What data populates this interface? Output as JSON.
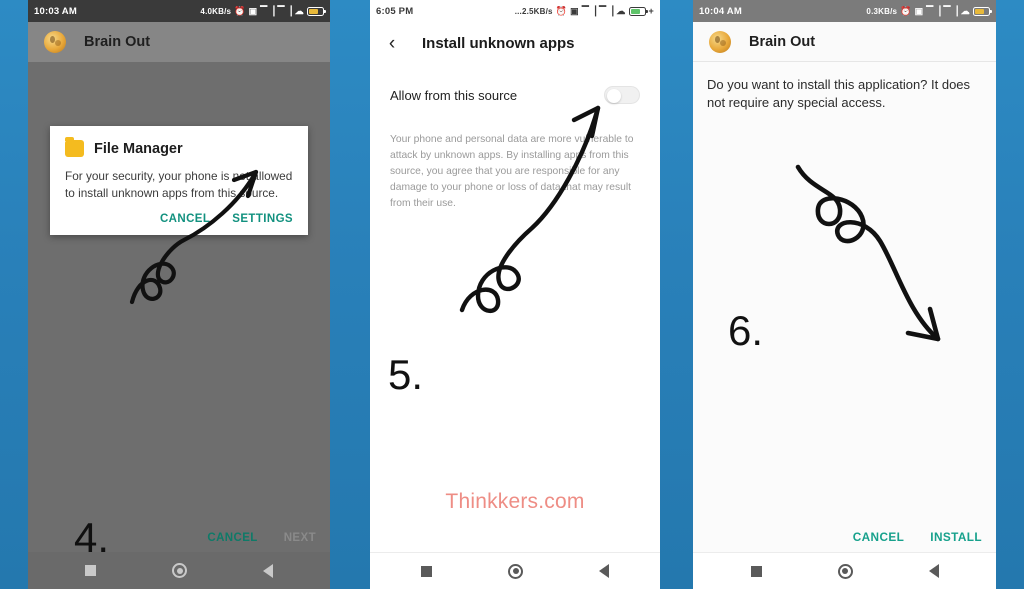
{
  "background": {
    "color_top": "#2d8bc4",
    "color_bottom": "#2478ae"
  },
  "panels": [
    {
      "id": "panel-1",
      "statusbar": {
        "time": "10:03 AM",
        "net_speed": "4.0KB/s",
        "icons": [
          "alarm-icon",
          "sd-card-icon",
          "signal-1-icon",
          "signal-2-icon",
          "wifi-icon",
          "battery-icon"
        ]
      },
      "appbar": {
        "title": "Brain Out",
        "icon": "brain-out-app-icon"
      },
      "dialog": {
        "icon": "folder-icon",
        "title": "File Manager",
        "message": "For your security, your phone is not allowed to install unknown apps from this source.",
        "cancel_label": "CANCEL",
        "settings_label": "SETTINGS",
        "action_color": "#12917f"
      },
      "bottom_actions": {
        "cancel_label": "CANCEL",
        "next_label": "NEXT",
        "next_disabled": true
      },
      "step_number": "4.",
      "navbar": {
        "recents": "recents-square-icon",
        "home": "home-circle-icon",
        "back": "back-triangle-icon"
      }
    },
    {
      "id": "panel-2",
      "statusbar": {
        "time": "6:05 PM",
        "net_speed": "...2.5KB/s",
        "icons": [
          "alarm-icon",
          "sd-card-icon",
          "signal-1-icon",
          "signal-2-icon",
          "wifi-icon",
          "battery-charging-icon"
        ]
      },
      "appbar": {
        "back_icon": "back-chevron-icon",
        "title": "Install unknown apps"
      },
      "setting": {
        "label": "Allow from this source",
        "toggle_state": "off",
        "toggle_name": "allow-from-this-source-toggle"
      },
      "description": "Your phone and personal data are more vulnerable to attack by unknown apps. By installing apps from this source, you agree that you are responsible for any damage to your phone or loss of data that may result from their use.",
      "watermark": "Thinkkers.com",
      "watermark_color": "#ee8d85",
      "step_number": "5.",
      "navbar": {
        "recents": "recents-square-icon",
        "home": "home-circle-icon",
        "back": "back-triangle-icon"
      }
    },
    {
      "id": "panel-3",
      "statusbar": {
        "time": "10:04 AM",
        "net_speed": "0.3KB/s",
        "icons": [
          "alarm-icon",
          "sd-card-icon",
          "signal-1-icon",
          "signal-2-icon",
          "wifi-icon",
          "battery-icon"
        ]
      },
      "appbar": {
        "title": "Brain Out",
        "icon": "brain-out-app-icon"
      },
      "question": "Do you want to install this application? It does not require any special access.",
      "bottom_actions": {
        "cancel_label": "CANCEL",
        "install_label": "INSTALL",
        "action_color": "#17a18c"
      },
      "step_number": "6.",
      "navbar": {
        "recents": "recents-square-icon",
        "home": "home-circle-icon",
        "back": "back-triangle-icon"
      }
    }
  ]
}
